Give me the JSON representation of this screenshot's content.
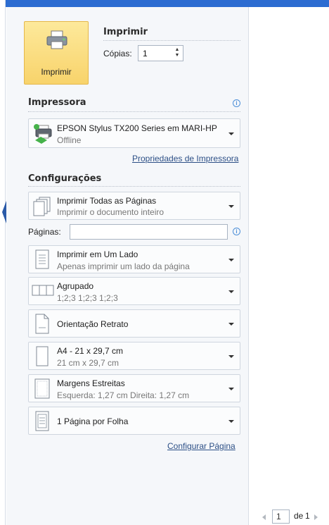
{
  "print": {
    "button_label": "Imprimir",
    "section_title": "Imprimir",
    "copies_label": "Cópias:",
    "copies_value": "1"
  },
  "printer": {
    "section_title": "Impressora",
    "name": "EPSON Stylus TX200 Series em MARI-HP",
    "status": "Offline",
    "properties_link": "Propriedades de Impressora"
  },
  "settings": {
    "section_title": "Configurações",
    "pages_label": "Páginas:",
    "pages_value": "",
    "options": [
      {
        "main": "Imprimir Todas as Páginas",
        "sub": "Imprimir o documento inteiro"
      },
      {
        "main": "Imprimir em Um Lado",
        "sub": "Apenas imprimir um lado da página"
      },
      {
        "main": "Agrupado",
        "sub": "1;2;3   1;2;3   1;2;3"
      },
      {
        "main": "Orientação Retrato",
        "sub": ""
      },
      {
        "main": "A4 - 21 x 29,7 cm",
        "sub": "21 cm x 29,7 cm"
      },
      {
        "main": "Margens Estreitas",
        "sub": "Esquerda: 1,27 cm   Direita: 1,27 cm"
      },
      {
        "main": "1 Página por Folha",
        "sub": ""
      }
    ],
    "page_setup_link": "Configurar Página"
  },
  "preview_nav": {
    "current_page": "1",
    "of_label": "de",
    "total_pages": "1"
  },
  "colors": {
    "accent_button": "#f8d36b",
    "link": "#2c4f86",
    "top_bar": "#2c6cd1"
  }
}
